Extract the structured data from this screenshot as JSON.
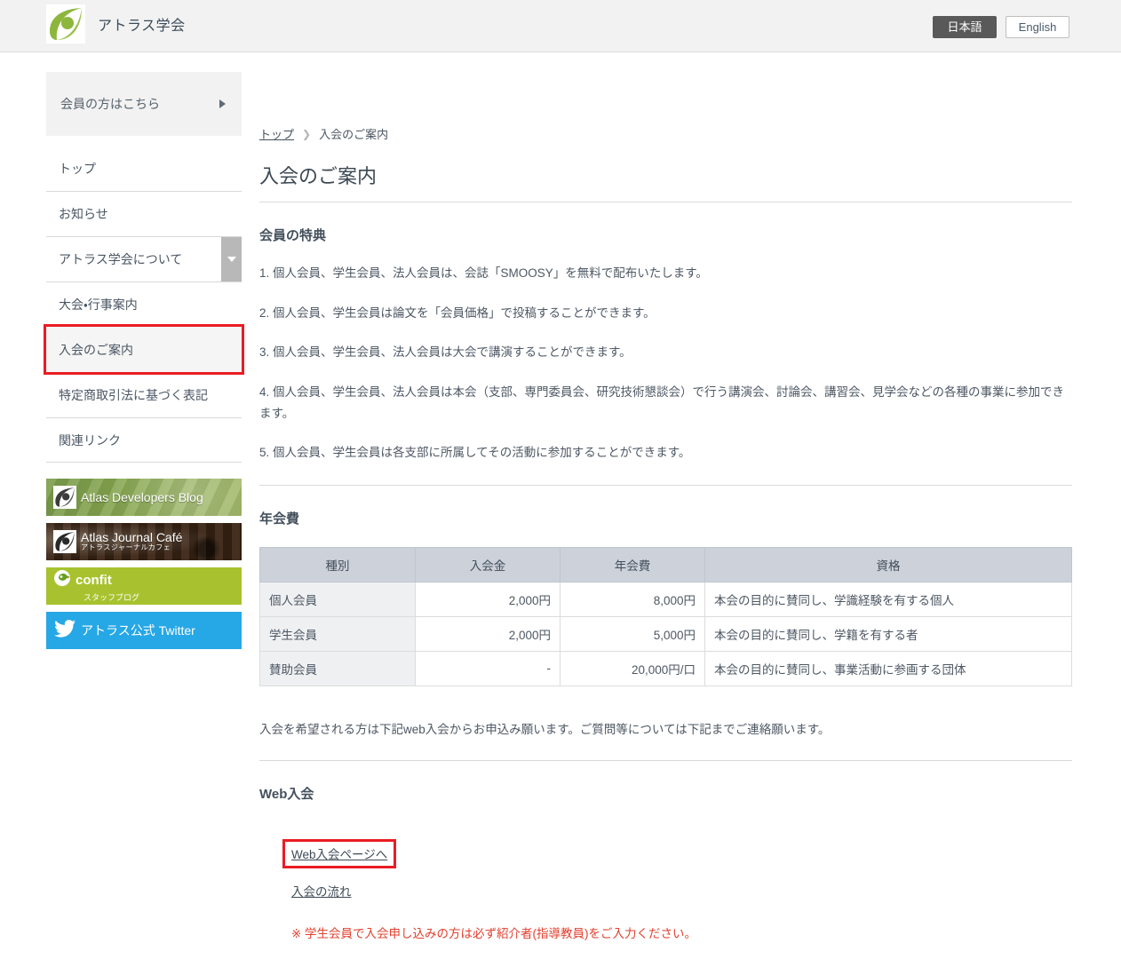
{
  "header": {
    "brand_name": "アトラス学会",
    "logo_icon": "atlas-leaf-logo",
    "lang_ja": "日本語",
    "lang_en": "English"
  },
  "sidebar": {
    "member_box": {
      "label": "会員の方はこちら",
      "icon": "triangle-right-icon"
    },
    "items": [
      {
        "label": "トップ",
        "dropdown": false,
        "highlighted": false
      },
      {
        "label": "お知らせ",
        "dropdown": false,
        "highlighted": false
      },
      {
        "label": "アトラス学会について",
        "dropdown": true,
        "dropdown_icon": "chevron-down-icon",
        "highlighted": false
      },
      {
        "label": "大会・行事案内",
        "dropdown": false,
        "highlighted": false
      },
      {
        "label": "入会のご案内",
        "dropdown": false,
        "highlighted": true
      },
      {
        "label": "特定商取引法に基づく表記",
        "dropdown": false,
        "highlighted": false
      },
      {
        "label": "関連リンク",
        "dropdown": false,
        "highlighted": false
      }
    ],
    "banners": [
      {
        "id": "atlas-developers-blog",
        "title": "Atlas Developers Blog",
        "sub": "",
        "icon": "atlas-leaf-logo"
      },
      {
        "id": "atlas-journal-cafe",
        "title": "Atlas Journal Café",
        "sub": "アトラスジャーナルカフェ",
        "icon": "atlas-leaf-logo"
      },
      {
        "id": "confit-staff-blog",
        "title": "confit",
        "sub": "スタッフブログ",
        "icon": "confit-bird-icon"
      },
      {
        "id": "atlas-official-twitter",
        "title": "アトラス公式 Twitter",
        "sub": "",
        "icon": "twitter-bird-icon"
      }
    ]
  },
  "breadcrumb": {
    "home": "トップ",
    "separator": "❯",
    "current": "入会のご案内"
  },
  "main": {
    "page_title": "入会のご案内",
    "benefits_heading": "会員の特典",
    "benefits": [
      "1. 個人会員、学生会員、法人会員は、会誌「SMOOSY」を無料で配布いたします。",
      "2. 個人会員、学生会員は論文を「会員価格」で投稿することができます。",
      "3. 個人会員、学生会員、法人会員は大会で講演することができます。",
      "4. 個人会員、学生会員、法人会員は本会（支部、専門委員会、研究技術懇談会）で行う講演会、討論会、講習会、見学会などの各種の事業に参加できます。",
      "5. 個人会員、学生会員は各支部に所属してその活動に参加することができます。"
    ],
    "fee_heading": "年会費",
    "fee_table": {
      "columns": [
        "種別",
        "入会金",
        "年会費",
        "資格"
      ],
      "rows": [
        [
          "個人会員",
          "2,000円",
          "8,000円",
          "本会の目的に賛同し、学識経験を有する個人"
        ],
        [
          "学生会員",
          "2,000円",
          "5,000円",
          "本会の目的に賛同し、学籍を有する者"
        ],
        [
          "賛助会員",
          "-",
          "20,000円/口",
          "本会の目的に賛同し、事業活動に参画する団体"
        ]
      ]
    },
    "contact_note": "入会を希望される方は下記web入会からお申込み願います。ご質問等については下記までご連絡願います。",
    "web_heading": "Web入会",
    "web_link": "Web入会ページへ",
    "flow_link": "入会の流れ",
    "warning": "※ 学生会員で入会申し込みの方は必ず紹介者(指導教員)をご入力ください。"
  },
  "colors": {
    "brand_green": "#8cb63c",
    "highlight_red": "#ea1c23",
    "warning_red": "#e0402f",
    "table_header": "#ccd1da",
    "twitter_blue": "#26a7e6",
    "confit_green": "#a7c22e"
  }
}
